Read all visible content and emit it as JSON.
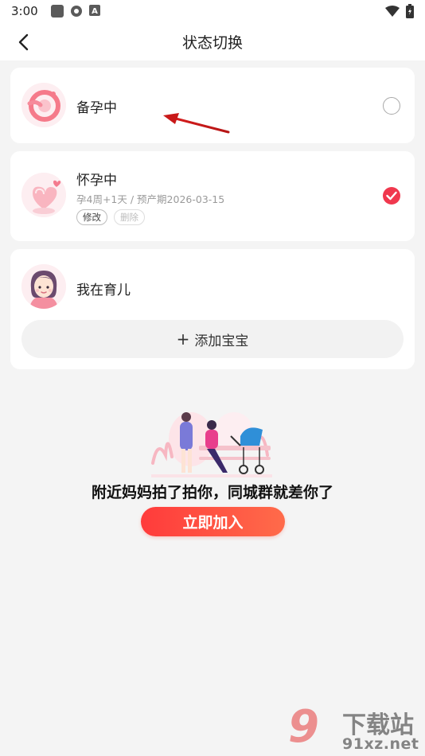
{
  "status_bar": {
    "time": "3:00",
    "icons": [
      "app-square-icon",
      "settings-gear-icon",
      "font-a-icon"
    ],
    "right_icons": [
      "wifi-icon",
      "battery-icon"
    ]
  },
  "header": {
    "title": "状态切换",
    "back_icon": "chevron-left-icon"
  },
  "states": [
    {
      "label": "备孕中",
      "selected": false,
      "icon": "preparing-avatar"
    },
    {
      "label": "怀孕中",
      "subtitle": "孕4周+1天 / 预产期2026-03-15",
      "selected": true,
      "icon": "pregnancy-heart-avatar",
      "actions": {
        "edit": "修改",
        "delete": "删除"
      }
    },
    {
      "label": "我在育儿",
      "selected": false,
      "icon": "mother-avatar",
      "add_baby": "添加宝宝"
    }
  ],
  "promo": {
    "text": "附近妈妈拍了拍你，同城群就差你了",
    "button": "立即加入"
  },
  "watermark": {
    "num": "9",
    "title": "下载站",
    "domain": "91xz.net"
  },
  "colors": {
    "accent": "#f0384e",
    "button_gradient_start": "#ff3b3b",
    "button_gradient_end": "#ff6b4a",
    "background": "#f4f4f4",
    "card": "#ffffff"
  }
}
